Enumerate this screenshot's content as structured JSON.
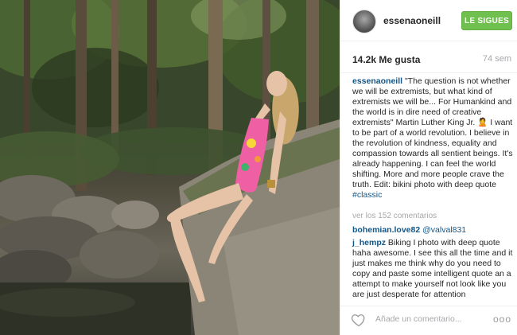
{
  "post": {
    "username": "essenaoneill",
    "follow_label": "LE SIGUES",
    "likes": "14.2k Me gusta",
    "time": "74 sem",
    "caption_username": "essenaoneill",
    "caption_text": " \"The question is not whether we will be extremists, but what kind of extremists we will be... For Humankind and the world is in dire need of creative extremists\" Martin Luther King Jr. 🙎 I want to be part of a world revolution. I believe in the revolution of kindness, equality and compassion towards all sentient beings. It's already happening. I can feel the world shifting. More and more people crave the truth. Edit: bikini photo with deep quote ",
    "hashtag": "#classic",
    "view_comments": "ver los 152 comentarios",
    "comments": [
      {
        "user": "bohemian.love82",
        "text": " ",
        "mention": "@valval831"
      },
      {
        "user": "j_hempz",
        "text": " Biking I photo with deep quote haha awesome. I see this all the time and it just makes me think why do you need to copy and paste some intelligent quote an a attempt to make yourself not look like you are just desperate for attention"
      }
    ],
    "add_comment_placeholder": "Añade un comentario...",
    "more_label": "ooo"
  },
  "colors": {
    "follow": "#70c050",
    "link": "#125688",
    "muted": "#a5a7aa"
  }
}
